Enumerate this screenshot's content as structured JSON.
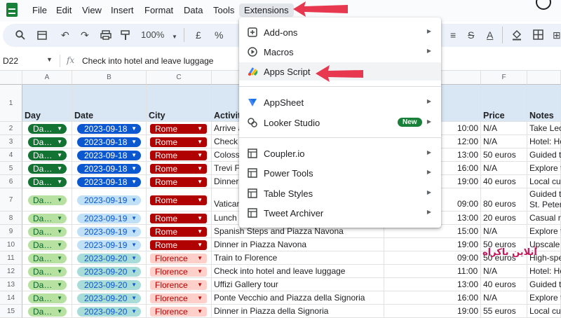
{
  "menubar": {
    "items": [
      "File",
      "Edit",
      "View",
      "Insert",
      "Format",
      "Data",
      "Tools",
      "Extensions"
    ]
  },
  "toolbar": {
    "zoom": "100%",
    "currency": "£",
    "percent": "%"
  },
  "formula_bar": {
    "cell_ref": "D22",
    "fx": "fx",
    "content": "Check into hotel and leave luggage"
  },
  "grid": {
    "columns": [
      "A",
      "B",
      "C",
      "D",
      "E",
      "F"
    ],
    "header_row": {
      "num": "1",
      "day": "Day",
      "date": "Date",
      "city": "City",
      "activity": "Activity",
      "price": "Price",
      "notes": "Notes"
    },
    "rows": [
      {
        "num": "2",
        "day": "Da…",
        "date": "2023-09-18",
        "city": "Rome",
        "activity": "Arrive a",
        "time": "10:00",
        "price": "N/A",
        "notes": "Take Leo"
      },
      {
        "num": "3",
        "day": "Da…",
        "date": "2023-09-18",
        "city": "Rome",
        "activity": "Check",
        "time": "12:00",
        "price": "N/A",
        "notes": "Hotel: Ho"
      },
      {
        "num": "4",
        "day": "Da…",
        "date": "2023-09-18",
        "city": "Rome",
        "activity": "Colosse",
        "time": "13:00",
        "price": "50 euros",
        "notes": "Guided t"
      },
      {
        "num": "5",
        "day": "Da…",
        "date": "2023-09-18",
        "city": "Rome",
        "activity": "Trevi F",
        "time": "16:00",
        "price": "N/A",
        "notes": "Explore t"
      },
      {
        "num": "6",
        "day": "Da…",
        "date": "2023-09-18",
        "city": "Rome",
        "activity": "Dinner",
        "time": "19:00",
        "price": "40 euros",
        "notes": "Local cui"
      },
      {
        "num": "7",
        "day": "Da…",
        "date": "2023-09-19",
        "city": "Rome",
        "activity": "Vatican",
        "time": "09:00",
        "price": "80 euros",
        "notes": "Guided t",
        "notes2": "St. Peter"
      },
      {
        "num": "8",
        "day": "Da…",
        "date": "2023-09-19",
        "city": "Rome",
        "activity": "Lunch",
        "time": "13:00",
        "price": "20 euros",
        "notes": "Casual re"
      },
      {
        "num": "9",
        "day": "Da…",
        "date": "2023-09-19",
        "city": "Rome",
        "activity": "Spanish Steps and Piazza Navona",
        "time": "15:00",
        "price": "N/A",
        "notes": "Explore t"
      },
      {
        "num": "10",
        "day": "Da…",
        "date": "2023-09-19",
        "city": "Rome",
        "activity": "Dinner in Piazza Navona",
        "time": "19:00",
        "price": "50 euros",
        "notes": "Upscale"
      },
      {
        "num": "11",
        "day": "Da…",
        "date": "2023-09-20",
        "city": "Florence",
        "activity": "Train to Florence",
        "time": "09:00",
        "price": "50 euros",
        "notes": "High-spe"
      },
      {
        "num": "12",
        "day": "Da…",
        "date": "2023-09-20",
        "city": "Florence",
        "activity": "Check into hotel and leave luggage",
        "time": "11:00",
        "price": "N/A",
        "notes": "Hotel: Ho"
      },
      {
        "num": "13",
        "day": "Da…",
        "date": "2023-09-20",
        "city": "Florence",
        "activity": "Uffizi Gallery tour",
        "time": "13:00",
        "price": "40 euros",
        "notes": "Guided t"
      },
      {
        "num": "14",
        "day": "Da…",
        "date": "2023-09-20",
        "city": "Florence",
        "activity": "Ponte Vecchio and Piazza della Signoria",
        "time": "16:00",
        "price": "N/A",
        "notes": "Explore t"
      },
      {
        "num": "15",
        "day": "Da…",
        "date": "2023-09-20",
        "city": "Florence",
        "activity": "Dinner in Piazza della Signoria",
        "time": "19:00",
        "price": "55 euros",
        "notes": "Local cui"
      }
    ]
  },
  "extensions_menu": {
    "items": [
      {
        "label": "Add-ons",
        "icon": "add-ons-icon",
        "submenu": true
      },
      {
        "label": "Macros",
        "icon": "macros-icon",
        "submenu": true
      },
      {
        "label": "Apps Script",
        "icon": "apps-script-icon",
        "submenu": false
      },
      {
        "label": "AppSheet",
        "icon": "appsheet-icon",
        "submenu": true
      },
      {
        "label": "Looker Studio",
        "icon": "looker-studio-icon",
        "submenu": true,
        "badge": "New"
      },
      {
        "label": "Coupler.io",
        "icon": "add-on-icon",
        "submenu": true
      },
      {
        "label": "Power Tools",
        "icon": "add-on-icon",
        "submenu": true
      },
      {
        "label": "Table Styles",
        "icon": "add-on-icon",
        "submenu": true
      },
      {
        "label": "Tweet Archiver",
        "icon": "add-on-icon",
        "submenu": true
      }
    ]
  },
  "watermark": {
    "text": "آنلاین باکراه"
  },
  "colors": {
    "day1_chip": "#137333",
    "day2_chip": "#b7e1a1",
    "day3_chip": "#b7e1a1",
    "date1_chip": "#0b57d0",
    "date2_chip": "#bfe0f6",
    "date3_chip": "#a8dcd9",
    "city_rome": "#b10202",
    "city_florence": "#ffcfc9",
    "annotation_arrow": "#e8384f"
  }
}
